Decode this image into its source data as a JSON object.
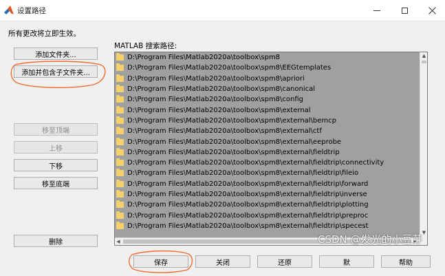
{
  "window": {
    "title": "设置路径",
    "controls": {
      "minimize_icon": "minimize-icon",
      "maximize_icon": "maximize-icon",
      "close_icon": "close-icon"
    }
  },
  "notice": "所有更改将立即生效。",
  "left_buttons": {
    "add_folder": "添加文件夹...",
    "add_with_subfolders": "添加并包含子文件夹...",
    "move_to_top": "移至顶端",
    "move_up": "上移",
    "move_down": "下移",
    "move_to_bottom": "移至底端",
    "remove": "删除"
  },
  "path_list": {
    "label": "MATLAB 搜索路径:",
    "items": [
      "D:\\Program Files\\Matlab2020a\\toolbox\\spm8",
      "D:\\Program Files\\Matlab2020a\\toolbox\\spm8\\EEGtemplates",
      "D:\\Program Files\\Matlab2020a\\toolbox\\spm8\\apriori",
      "D:\\Program Files\\Matlab2020a\\toolbox\\spm8\\canonical",
      "D:\\Program Files\\Matlab2020a\\toolbox\\spm8\\config",
      "D:\\Program Files\\Matlab2020a\\toolbox\\spm8\\external",
      "D:\\Program Files\\Matlab2020a\\toolbox\\spm8\\external\\bemcp",
      "D:\\Program Files\\Matlab2020a\\toolbox\\spm8\\external\\ctf",
      "D:\\Program Files\\Matlab2020a\\toolbox\\spm8\\external\\eeprobe",
      "D:\\Program Files\\Matlab2020a\\toolbox\\spm8\\external\\fieldtrip",
      "D:\\Program Files\\Matlab2020a\\toolbox\\spm8\\external\\fieldtrip\\connectivity",
      "D:\\Program Files\\Matlab2020a\\toolbox\\spm8\\external\\fieldtrip\\fileio",
      "D:\\Program Files\\Matlab2020a\\toolbox\\spm8\\external\\fieldtrip\\forward",
      "D:\\Program Files\\Matlab2020a\\toolbox\\spm8\\external\\fieldtrip\\inverse",
      "D:\\Program Files\\Matlab2020a\\toolbox\\spm8\\external\\fieldtrip\\plotting",
      "D:\\Program Files\\Matlab2020a\\toolbox\\spm8\\external\\fieldtrip\\preproc",
      "D:\\Program Files\\Matlab2020a\\toolbox\\spm8\\external\\fieldtrip\\specest"
    ],
    "item_icon": "folder-icon"
  },
  "bottom_buttons": {
    "save": "保存",
    "close": "关闭",
    "restore": "还原",
    "default": "默",
    "help": "帮助"
  },
  "watermark": "CSDN @发光的小豆芽",
  "colors": {
    "list_selected_bg": "#a0a0a0",
    "folder": "#f6d16b",
    "annotation": "#f26a2e"
  }
}
